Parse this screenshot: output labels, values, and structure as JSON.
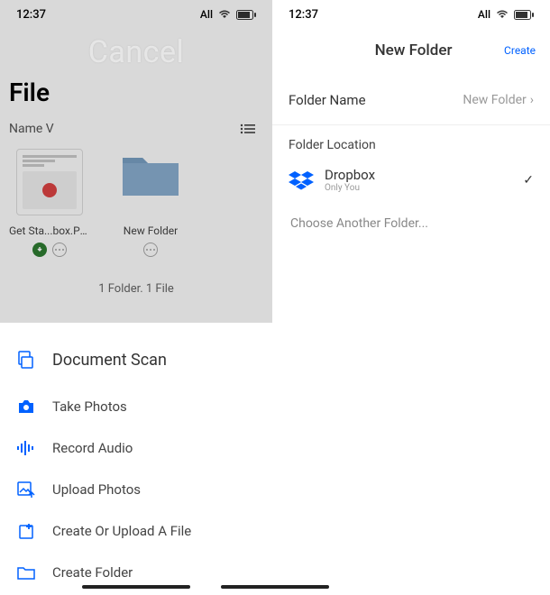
{
  "left": {
    "status": {
      "time": "12:37",
      "network": "All"
    },
    "cancel_label": "Cancel",
    "title": "File",
    "sort_label": "Name V",
    "files": [
      {
        "name": "Get Sta...box.PDF"
      },
      {
        "name": "New Folder"
      }
    ],
    "summary": "1 Folder. 1 File",
    "actions": {
      "scan": "Document Scan",
      "take_photos": "Take Photos",
      "record_audio": "Record Audio",
      "upload_photos": "Upload Photos",
      "create_upload": "Create Or Upload A File",
      "create_folder": "Create Folder"
    }
  },
  "right": {
    "status": {
      "time": "12:37",
      "network": "All"
    },
    "header": {
      "title": "New Folder",
      "create": "Create"
    },
    "folder_name": {
      "label": "Folder Name",
      "value": "New Folder"
    },
    "section_label": "Folder Location",
    "location": {
      "name": "Dropbox",
      "sub": "Only You"
    },
    "choose_another": "Choose Another Folder..."
  }
}
